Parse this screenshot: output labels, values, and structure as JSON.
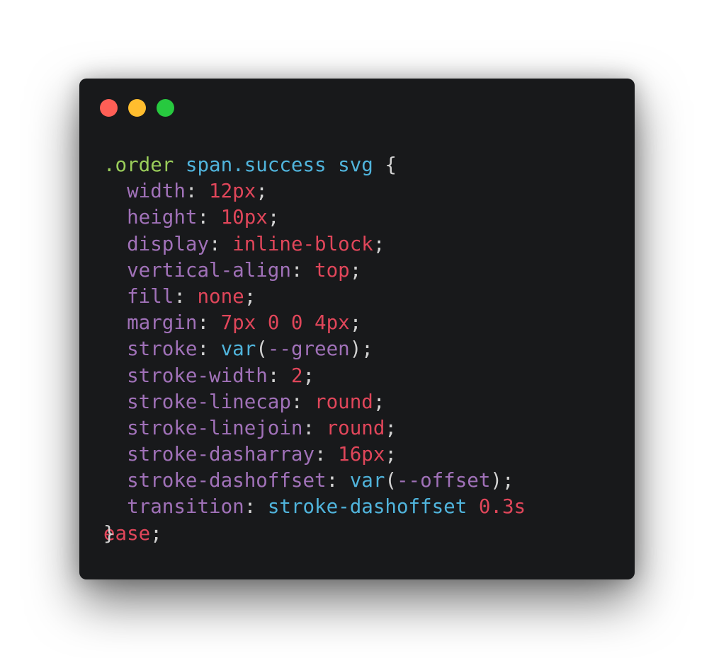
{
  "window": {
    "buttons": {
      "close_color": "#ff5f56",
      "minimize_color": "#ffbd2e",
      "maximize_color": "#27c93f"
    }
  },
  "code": {
    "line1": {
      "selector_class": ".order",
      "space1": " ",
      "selector_mid": "span.success",
      "space2": " ",
      "selector_tag": "svg",
      "brace": " {"
    },
    "line2": {
      "indent": "  ",
      "prop": "width",
      "colon": ": ",
      "value": "12px",
      "semi": ";"
    },
    "line3": {
      "indent": "  ",
      "prop": "height",
      "colon": ": ",
      "value": "10px",
      "semi": ";"
    },
    "line4": {
      "indent": "  ",
      "prop": "display",
      "colon": ": ",
      "value": "inline-block",
      "semi": ";"
    },
    "line5": {
      "indent": "  ",
      "prop": "vertical-align",
      "colon": ": ",
      "value": "top",
      "semi": ";"
    },
    "line6": {
      "indent": "  ",
      "prop": "fill",
      "colon": ": ",
      "value": "none",
      "semi": ";"
    },
    "line7": {
      "indent": "  ",
      "prop": "margin",
      "colon": ": ",
      "value": "7px 0 0 4px",
      "semi": ";"
    },
    "line8": {
      "indent": "  ",
      "prop": "stroke",
      "colon": ": ",
      "func": "var",
      "open": "(",
      "var": "--green",
      "close": ")",
      "semi": ";"
    },
    "line9": {
      "indent": "  ",
      "prop": "stroke-width",
      "colon": ": ",
      "value": "2",
      "semi": ";"
    },
    "line10": {
      "indent": "  ",
      "prop": "stroke-linecap",
      "colon": ": ",
      "value": "round",
      "semi": ";"
    },
    "line11": {
      "indent": "  ",
      "prop": "stroke-linejoin",
      "colon": ": ",
      "value": "round",
      "semi": ";"
    },
    "line12": {
      "indent": "  ",
      "prop": "stroke-dasharray",
      "colon": ": ",
      "value": "16px",
      "semi": ";"
    },
    "line13": {
      "indent": "  ",
      "prop": "stroke-dashoffset",
      "colon": ": ",
      "func": "var",
      "open": "(",
      "var": "--offset",
      "close": ")",
      "semi": ";"
    },
    "line14": {
      "indent": "  ",
      "prop": "transition",
      "colon": ": ",
      "value_name": "stroke-dashoffset",
      "space": " ",
      "value_time": "0.3s"
    },
    "line15": {
      "brace": "}",
      "value": "ease",
      "semi": ";"
    }
  }
}
